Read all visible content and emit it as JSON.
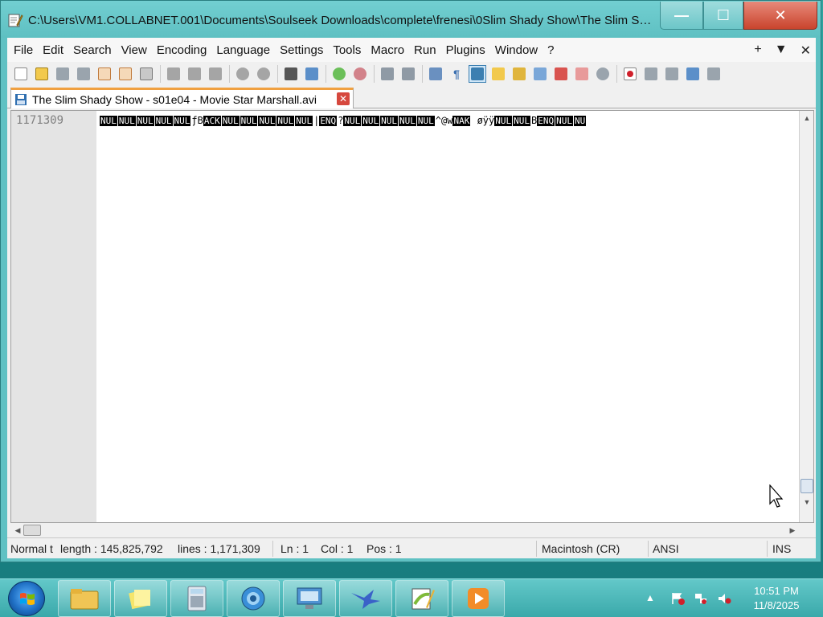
{
  "window": {
    "title": "C:\\Users\\VM1.COLLABNET.001\\Documents\\Soulseek Downloads\\complete\\frenesi\\0Slim Shady Show\\The Slim Shady ..."
  },
  "menubar": {
    "items": [
      "File",
      "Edit",
      "Search",
      "View",
      "Encoding",
      "Language",
      "Settings",
      "Tools",
      "Macro",
      "Run",
      "Plugins",
      "Window",
      "?"
    ],
    "right": [
      "+",
      "▼",
      "✕"
    ]
  },
  "tab": {
    "label": "The Slim Shady Show - s01e04 - Movie Star Marshall.avi"
  },
  "editor": {
    "line_number": "1171309",
    "segments": [
      {
        "t": "NUL",
        "c": true
      },
      {
        "t": "NUL",
        "c": true
      },
      {
        "t": "NUL",
        "c": true
      },
      {
        "t": "NUL",
        "c": true
      },
      {
        "t": "NUL",
        "c": true
      },
      {
        "t": "ƒB",
        "c": false
      },
      {
        "t": "ACK",
        "c": true
      },
      {
        "t": "NUL",
        "c": true
      },
      {
        "t": "NUL",
        "c": true
      },
      {
        "t": "NUL",
        "c": true
      },
      {
        "t": "NUL",
        "c": true
      },
      {
        "t": "NUL",
        "c": true
      },
      {
        "t": "|",
        "c": false
      },
      {
        "t": "ENQ",
        "c": true
      },
      {
        "t": "?",
        "c": false
      },
      {
        "t": "NUL",
        "c": true
      },
      {
        "t": "NUL",
        "c": true
      },
      {
        "t": "NUL",
        "c": true
      },
      {
        "t": "NUL",
        "c": true
      },
      {
        "t": "NUL",
        "c": true
      },
      {
        "t": "^@w",
        "c": false
      },
      {
        "t": "NAK",
        "c": true
      },
      {
        "t": " øÿÿ",
        "c": false
      },
      {
        "t": "NUL",
        "c": true
      },
      {
        "t": "NUL",
        "c": true
      },
      {
        "t": "B",
        "c": false
      },
      {
        "t": "ENQ",
        "c": true
      },
      {
        "t": "NUL",
        "c": true
      },
      {
        "t": "NU",
        "c": true
      }
    ]
  },
  "status": {
    "mode": "Normal t",
    "length": "length : 145,825,792",
    "lines": "lines : 1,171,309",
    "ln": "Ln : 1",
    "col": "Col : 1",
    "pos": "Pos : 1",
    "eol": "Macintosh (CR)",
    "encoding": "ANSI",
    "ins": "INS"
  },
  "taskbar": {
    "time": "10:51 PM",
    "date": "11/8/2025"
  },
  "colors": {
    "accent": "#5fc1c3",
    "close": "#c9442d",
    "tab_highlight": "#f0a040"
  }
}
